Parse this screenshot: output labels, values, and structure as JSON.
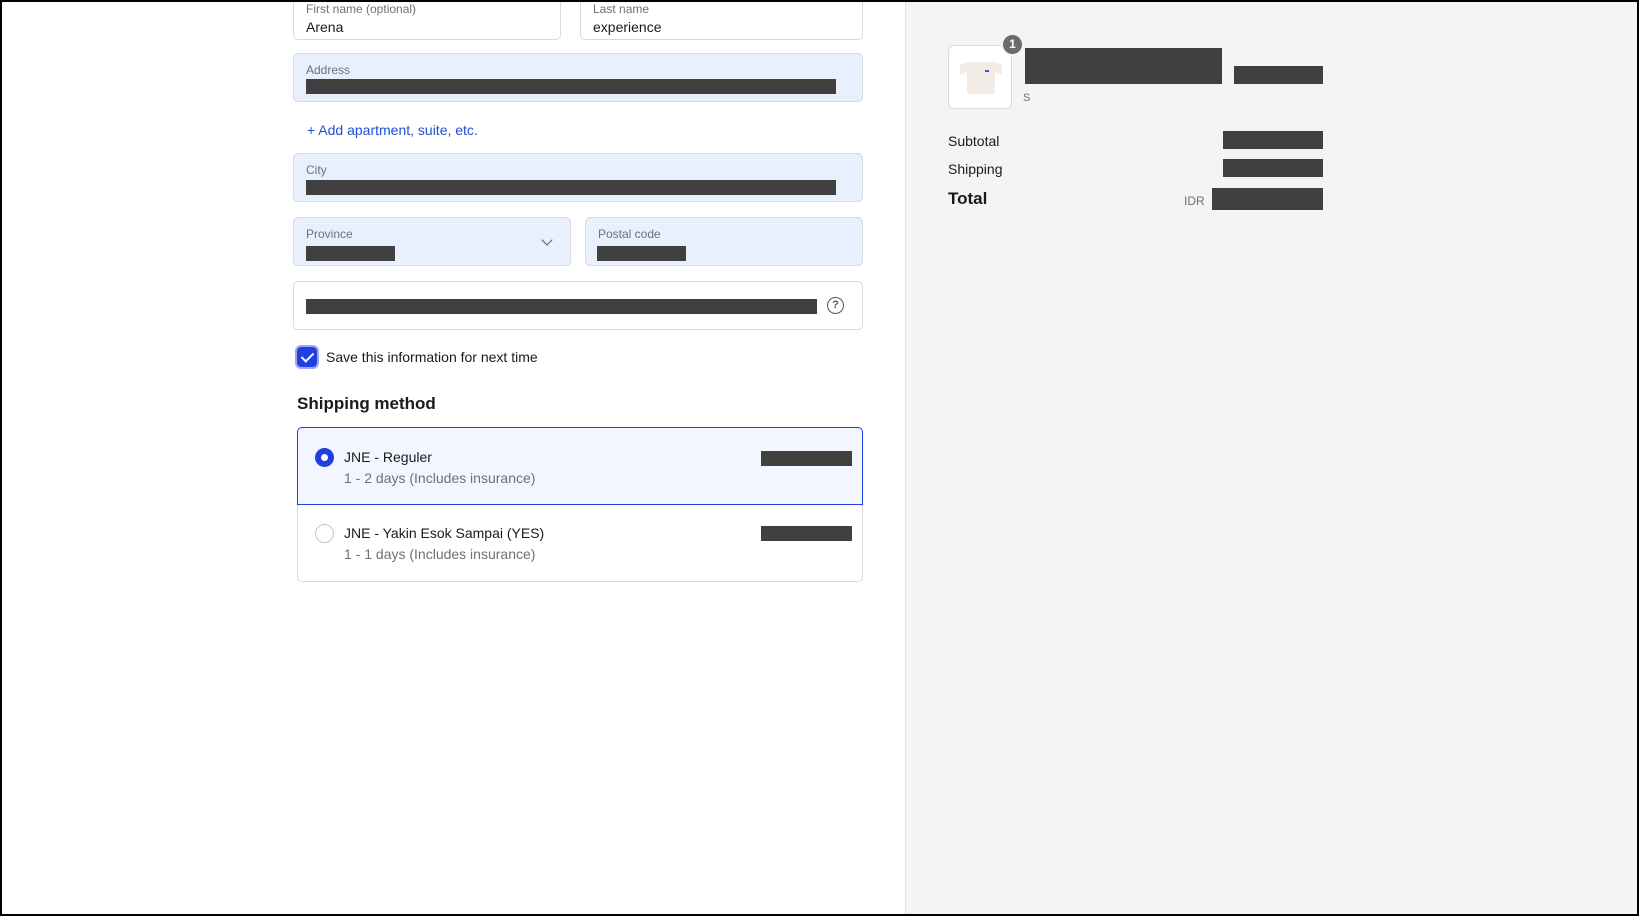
{
  "form": {
    "first_name": {
      "label": "First name (optional)",
      "value": "Arena"
    },
    "last_name": {
      "label": "Last name",
      "value": "experience"
    },
    "address": {
      "label": "Address"
    },
    "add_apartment_link": "+ Add apartment, suite, etc.",
    "city": {
      "label": "City"
    },
    "province": {
      "label": "Province"
    },
    "postal_code": {
      "label": "Postal code"
    },
    "help_icon_glyph": "?",
    "save_info_label": "Save this information for next time",
    "save_info_checked": true
  },
  "shipping": {
    "title": "Shipping method",
    "options": [
      {
        "name": "JNE - Reguler",
        "detail": "1 - 2 days (Includes insurance)",
        "selected": true
      },
      {
        "name": "JNE - Yakin Esok Sampai (YES)",
        "detail": "1 - 1 days (Includes insurance)",
        "selected": false
      }
    ]
  },
  "summary": {
    "item": {
      "quantity": "1",
      "variant": "S",
      "icon": "tshirt-thumbnail"
    },
    "subtotal_label": "Subtotal",
    "shipping_label": "Shipping",
    "total_label": "Total",
    "currency": "IDR"
  },
  "colors": {
    "accent": "#1f3fe0",
    "autofill_bg": "#e8f0fe",
    "redaction": "#404040",
    "sidebar_bg": "#f4f4f4"
  }
}
